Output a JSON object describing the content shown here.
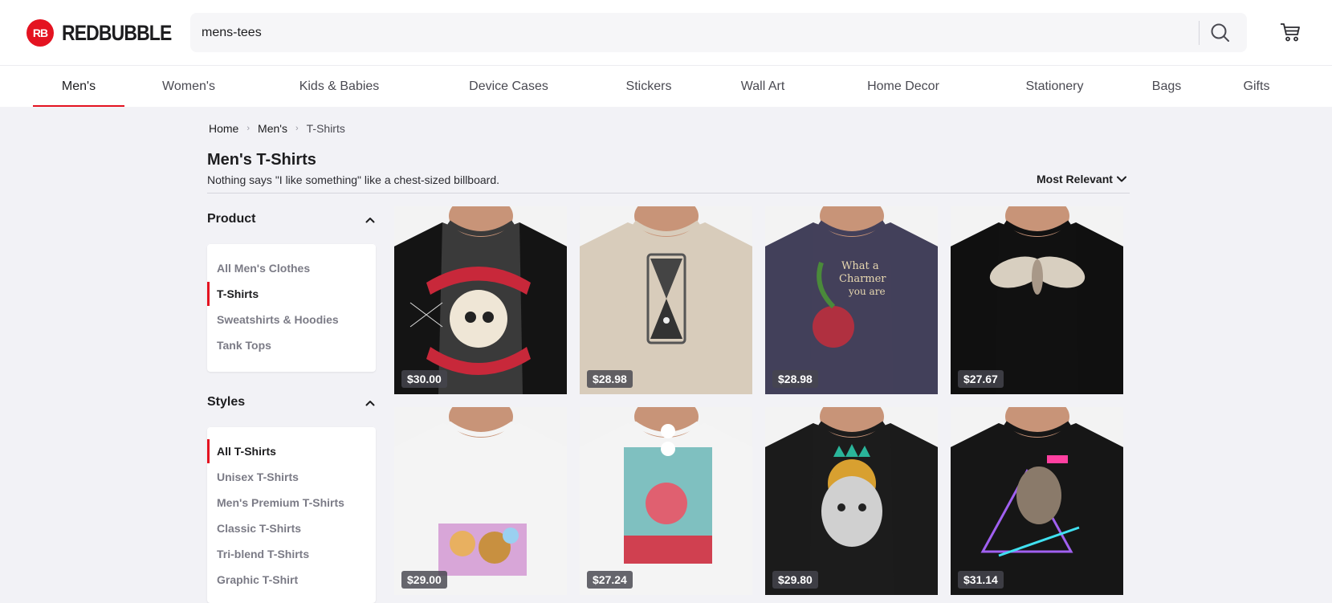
{
  "header": {
    "logo_mark": "RB",
    "logo_text": "REDBUBBLE",
    "search_value": "mens-tees"
  },
  "nav": {
    "items": [
      "Men's",
      "Women's",
      "Kids & Babies",
      "Device Cases",
      "Stickers",
      "Wall Art",
      "Home Decor",
      "Stationery",
      "Bags",
      "Gifts"
    ],
    "active": "Men's"
  },
  "breadcrumb": {
    "home": "Home",
    "mens": "Men's",
    "current": "T-Shirts"
  },
  "page": {
    "title": "Men's T-Shirts",
    "subtitle": "Nothing says \"I like something\" like a chest-sized billboard.",
    "sort_label": "Most Relevant"
  },
  "filters": {
    "product": {
      "heading": "Product",
      "items": [
        "All Men's Clothes",
        "T-Shirts",
        "Sweatshirts & Hoodies",
        "Tank Tops"
      ],
      "active": "T-Shirts"
    },
    "styles": {
      "heading": "Styles",
      "items": [
        "All T-Shirts",
        "Unisex T-Shirts",
        "Men's Premium T-Shirts",
        "Classic T-Shirts",
        "Tri-blend T-Shirts",
        "Graphic T-Shirt"
      ],
      "active": "All T-Shirts"
    }
  },
  "products": [
    {
      "price": "$30.00",
      "shirt_color": "#3a3a3a",
      "sleeve_color": "#111111",
      "design": "skull-banner"
    },
    {
      "price": "$28.98",
      "shirt_color": "#d8ccbb",
      "sleeve_color": "#d8ccbb",
      "design": "hourglass"
    },
    {
      "price": "$28.98",
      "shirt_color": "#43405a",
      "sleeve_color": "#43405a",
      "design": "snake-cherry"
    },
    {
      "price": "$27.67",
      "shirt_color": "#111111",
      "sleeve_color": "#111111",
      "design": "moth"
    },
    {
      "price": "$29.00",
      "shirt_color": "#f4f4f4",
      "sleeve_color": "#f4f4f4",
      "design": "leopard"
    },
    {
      "price": "$27.24",
      "shirt_color": "#f4f4f4",
      "sleeve_color": "#f4f4f4",
      "design": "flower-figure"
    },
    {
      "price": "$29.80",
      "shirt_color": "#1c1c1c",
      "sleeve_color": "#1c1c1c",
      "design": "lion"
    },
    {
      "price": "$31.14",
      "shirt_color": "#161616",
      "sleeve_color": "#161616",
      "design": "trex"
    }
  ],
  "colors": {
    "brand": "#e41321",
    "background": "#f2f2f6"
  }
}
